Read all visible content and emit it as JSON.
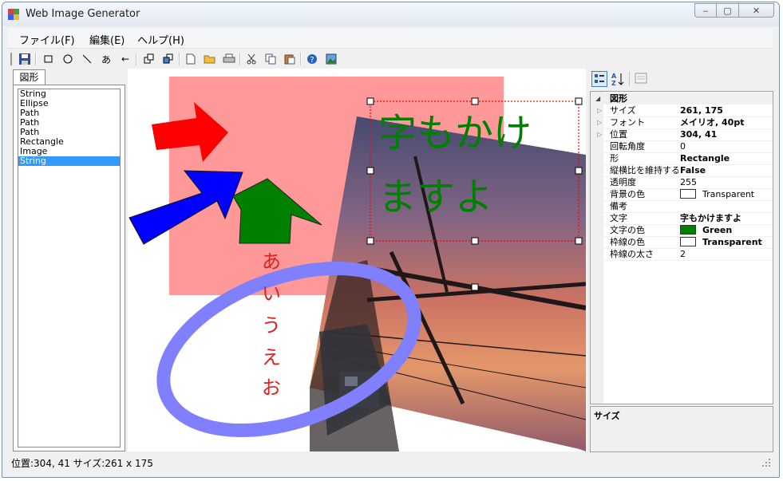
{
  "window": {
    "title": "Web Image Generator",
    "min_label": "‒",
    "max_label": "▢",
    "close_label": "✕"
  },
  "menu": [
    {
      "label": "ファイル(F)"
    },
    {
      "label": "編集(E)"
    },
    {
      "label": "ヘルプ(H)"
    }
  ],
  "toolbar": {
    "icons": [
      "save-icon",
      "rectangle-tool-icon",
      "ellipse-tool-icon",
      "line-tool-icon",
      "text-tool-icon",
      "arrow-tool-icon",
      "bring-front-icon",
      "send-back-icon",
      "new-file-icon",
      "open-folder-icon",
      "print-icon",
      "cut-icon",
      "copy-icon",
      "paste-icon",
      "help-icon",
      "image-icon"
    ],
    "text_tool_label": "あ",
    "arrow_tool_label": "←"
  },
  "shapes_tab": {
    "label": "図形",
    "items": [
      "String",
      "Ellipse",
      "Path",
      "Path",
      "Path",
      "Rectangle",
      "Image",
      "String"
    ],
    "selected_index": 7
  },
  "canvas": {
    "main_text_line1": "字もかけ",
    "main_text_line2": "ますよ",
    "vertical_text": [
      "あ",
      "い",
      "う",
      "え",
      "お"
    ],
    "colors": {
      "pink_rect": "#ff9999",
      "red_arrow": "#ff0000",
      "blue_arrow": "#0000ff",
      "green_arrow": "#008000",
      "ellipse": "#8080ff",
      "main_text": "#008000",
      "vertical_text": "#e02020"
    }
  },
  "properties": {
    "category": "図形",
    "rows": [
      {
        "name": "サイズ",
        "value": "261, 175",
        "bold": true,
        "expand": true
      },
      {
        "name": "フォント",
        "value": "メイリオ, 40pt",
        "bold": true,
        "expand": true
      },
      {
        "name": "位置",
        "value": "304, 41",
        "bold": true,
        "expand": true
      },
      {
        "name": "回転角度",
        "value": "0",
        "bold": false
      },
      {
        "name": "形",
        "value": "Rectangle",
        "bold": true
      },
      {
        "name": "縦横比を維持する",
        "value": "False",
        "bold": true
      },
      {
        "name": "透明度",
        "value": "255",
        "bold": false
      },
      {
        "name": "背景の色",
        "value": "Transparent",
        "bold": false,
        "swatch": "#ffffff"
      },
      {
        "name": "備考",
        "value": "",
        "bold": false
      },
      {
        "name": "文字",
        "value": "字もかけますよ",
        "bold": true
      },
      {
        "name": "文字の色",
        "value": "Green",
        "bold": true,
        "swatch": "#008000"
      },
      {
        "name": "枠線の色",
        "value": "Transparent",
        "bold": true,
        "swatch": "#ffffff"
      },
      {
        "name": "枠線の太さ",
        "value": "2",
        "bold": false
      }
    ],
    "description_title": "サイズ"
  },
  "status": {
    "text": "位置:304, 41 サイズ:261 x 175"
  }
}
